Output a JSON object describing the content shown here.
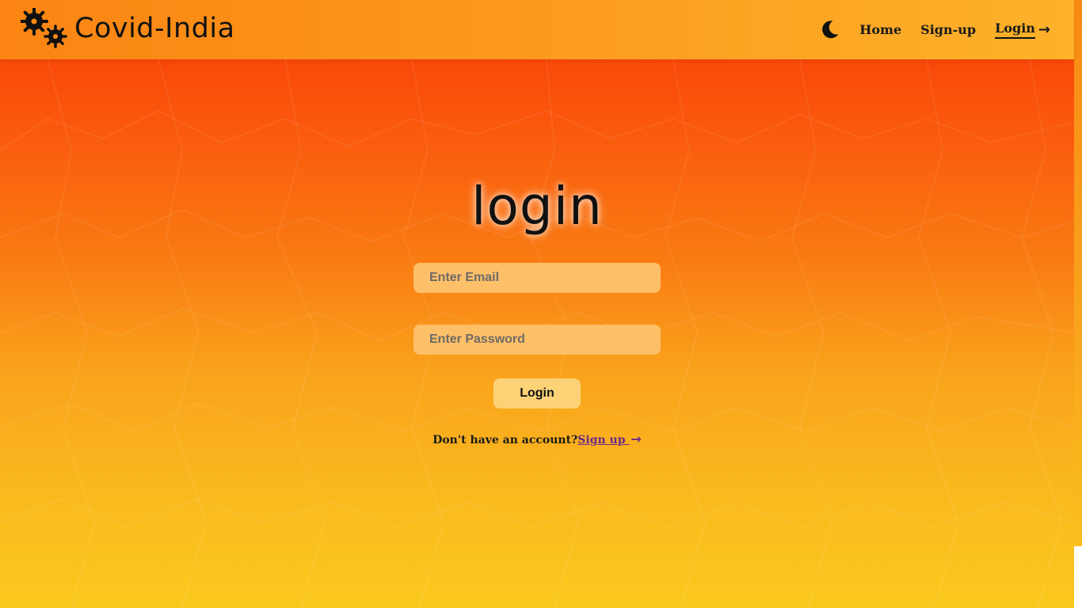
{
  "brand": {
    "name": "Covid-India",
    "logo_icon": "virus-gears-icon"
  },
  "nav": {
    "theme_icon": "moon-icon",
    "items": [
      {
        "label": "Home"
      },
      {
        "label": "Sign-up"
      },
      {
        "label": "Login",
        "arrow": "→",
        "active": true
      }
    ]
  },
  "login": {
    "title": "login",
    "email_placeholder": "Enter Email",
    "password_placeholder": "Enter Password",
    "button_label": "Login",
    "signup_prompt": "Don't have an account?",
    "signup_link": "Sign up ",
    "signup_arrow": "→"
  },
  "colors": {
    "bg_top": "#f93a05",
    "bg_bottom": "#fbc91e",
    "navbar": "#fc9a1e",
    "input_bg": "#fdbf68",
    "button_bg": "#fdd277",
    "link": "#6b2a8c"
  }
}
